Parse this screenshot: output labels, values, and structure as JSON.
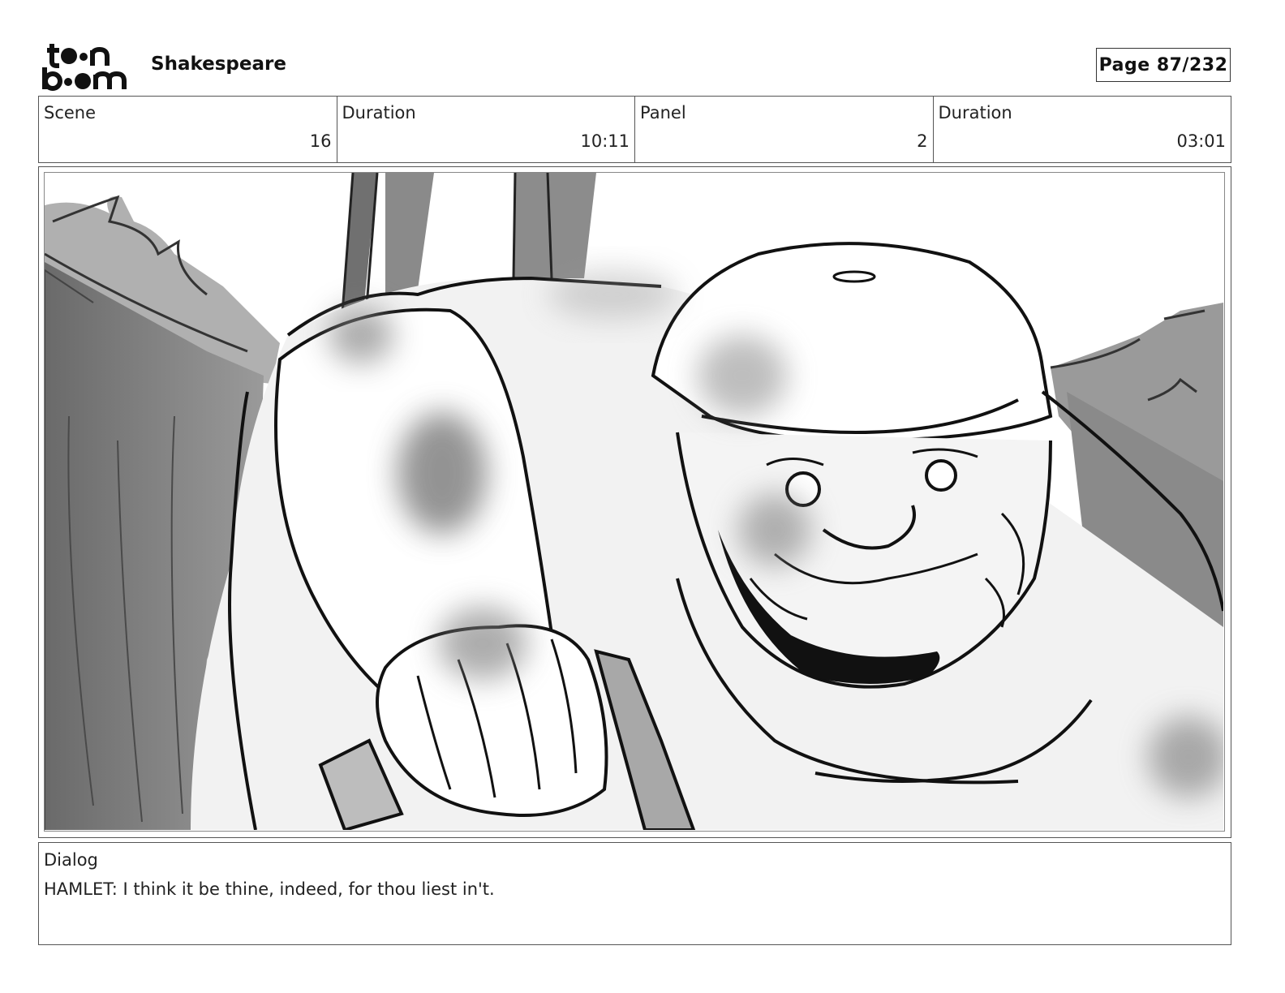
{
  "header": {
    "logo_text": "toon boom",
    "project_title": "Shakespeare",
    "page_label": "Page 87/232"
  },
  "info": {
    "scene_label": "Scene",
    "scene_value": "16",
    "scene_duration_label": "Duration",
    "scene_duration_value": "10:11",
    "panel_label": "Panel",
    "panel_value": "2",
    "panel_duration_label": "Duration",
    "panel_duration_value": "03:01"
  },
  "dialog": {
    "label": "Dialog",
    "text": "HAMLET: I think it be thine, indeed, for thou liest in't."
  }
}
